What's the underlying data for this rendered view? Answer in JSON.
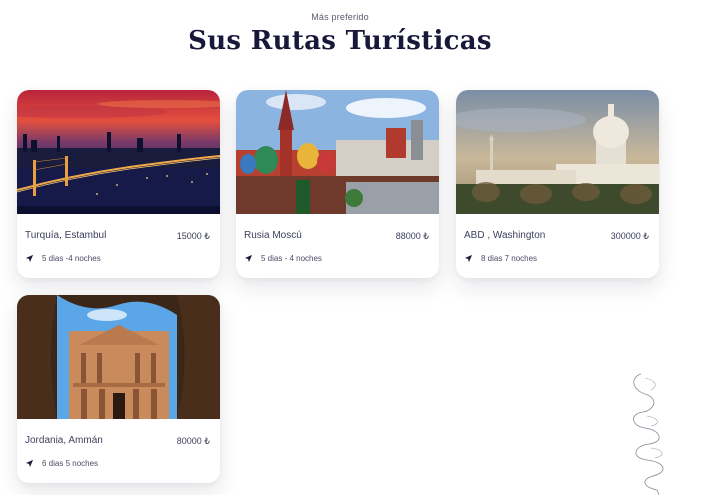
{
  "header": {
    "eyebrow": "Más preferido",
    "title": "Sus Rutas Turísticas"
  },
  "tours": [
    {
      "name": "Turquía, Estambul",
      "price": "15000 ₺",
      "duration": "5 dias -4 noches",
      "photo": "istanbul-bridge-sunset"
    },
    {
      "name": "Rusia Moscú",
      "price": "88000 ₺",
      "duration": "5 dias - 4 noches",
      "photo": "moscow-st-basils"
    },
    {
      "name": "ABD , Washington",
      "price": "300000 ₺",
      "duration": "8 dias 7 noches",
      "photo": "washington-capitol"
    },
    {
      "name": "Jordania, Ammán",
      "price": "80000 ₺",
      "duration": "6 dias 5 noches",
      "photo": "petra-treasury"
    }
  ],
  "icons": {
    "duration": "navigation-arrow-icon",
    "decoration": "spiral-line-icon"
  }
}
